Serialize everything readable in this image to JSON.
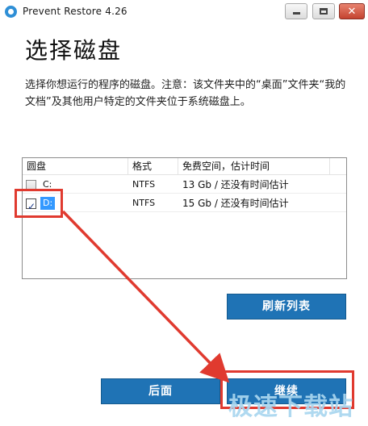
{
  "window": {
    "title": "Prevent Restore 4.26",
    "close_glyph": "✕"
  },
  "heading": "选择磁盘",
  "description": "选择你想运行的程序的磁盘。注意：该文件夹中的“桌面”文件夹“我的文档”及其他用户特定的文件夹位于系统磁盘上。",
  "disk_list": {
    "columns": [
      "圆盘",
      "格式",
      "免费空间，估计时间"
    ],
    "rows": [
      {
        "drive": "C:",
        "format": "NTFS",
        "free": "13 Gb / 还没有时间估计",
        "checked": false
      },
      {
        "drive": "D:",
        "format": "NTFS",
        "free": "15 Gb / 还没有时间估计",
        "checked": true
      }
    ]
  },
  "buttons": {
    "refresh": "刷新列表",
    "back": "后面",
    "next": "继续"
  },
  "watermark": "极速下载站",
  "colors": {
    "button": "#1f73b5",
    "highlight": "#e03a2f",
    "selection": "#3399ff"
  },
  "icons": {
    "app": "prevent-restore-app-icon",
    "minimize": "minimize-icon",
    "maximize": "maximize-icon",
    "close": "close-icon",
    "checkbox_tick": "check-icon"
  }
}
